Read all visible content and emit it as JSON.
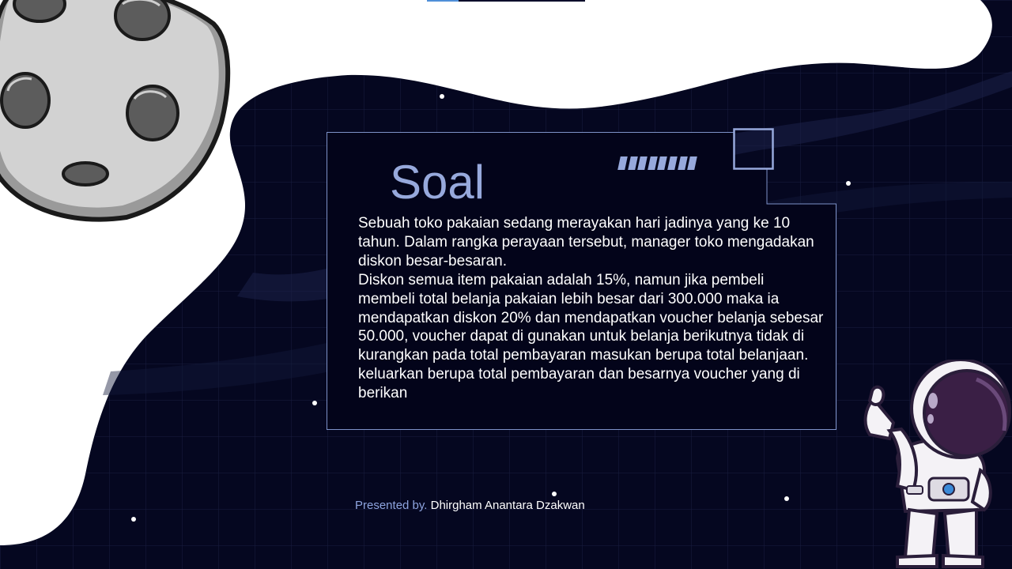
{
  "slide": {
    "title": "Soal",
    "paragraphs": [
      "Sebuah toko pakaian sedang merayakan hari jadinya yang ke 10 tahun. Dalam rangka perayaan tersebut, manager toko mengadakan diskon besar-besaran.",
      "Diskon semua item pakaian adalah 15%, namun jika pembeli membeli total belanja pakaian lebih besar dari 300.000 maka ia mendapatkan diskon 20% dan mendapatkan voucher belanja sebesar 50.000, voucher dapat di gunakan untuk belanja berikutnya tidak di kurangkan pada total pembayaran masukan berupa total belanjaan.",
      "keluarkan berupa total pembayaran dan besarnya voucher yang di berikan"
    ],
    "presenter_label": "Presented by.",
    "presenter_name": "Dhirgham Anantara Dzakwan"
  },
  "progress": {
    "fraction": 0.2
  },
  "colors": {
    "background_dark": "#050720",
    "accent": "#97a9dc",
    "text": "#ffffff",
    "progress_fill": "#4f8fd8"
  },
  "decor": {
    "illustration_left": "moon-illustration",
    "illustration_right": "astronaut-illustration",
    "title_accent": "stripes-icon"
  }
}
